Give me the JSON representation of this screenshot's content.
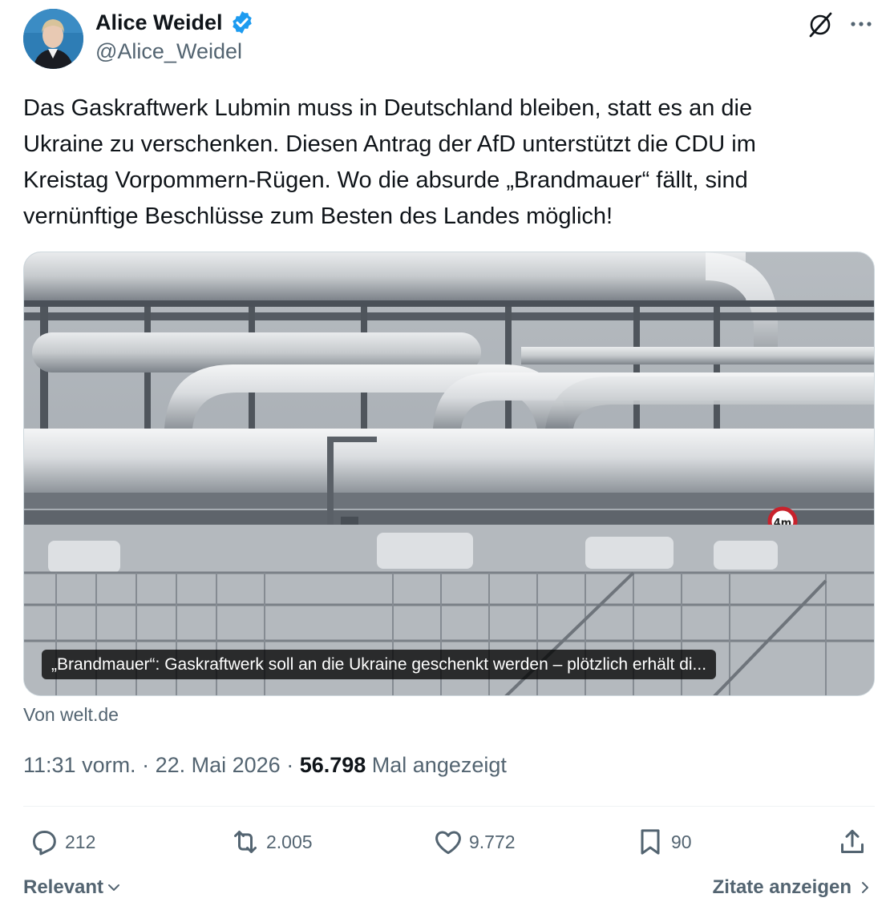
{
  "author": {
    "display_name": "Alice Weidel",
    "handle": "@Alice_Weidel",
    "avatar_icon": "profile-photo",
    "verified_color": "#1d9bf0"
  },
  "tweet": {
    "lines": [
      "Das Gaskraftwerk Lubmin muss in Deutschland bleiben, statt es an die",
      "Ukraine zu verschenken. Diesen Antrag der AfD unterstützt die CDU im",
      "Kreistag Vorpommern-Rügen. Wo die absurde „Brandmauer“ fällt, sind",
      "vernünftige Beschlüsse zum Besten des Landes möglich!"
    ]
  },
  "card": {
    "caption": "„Brandmauer“: Gaskraftwerk soll an die Ukraine geschenkt werden – plötzlich erhält di...",
    "sign_text": "4m",
    "source": "Von welt.de"
  },
  "meta": {
    "time": "11:31 vorm.",
    "sep1": " · ",
    "date": "22. Mai 2026",
    "sep2": " · ",
    "views": "56.798",
    "views_label": " Mal angezeigt"
  },
  "actions": {
    "replies": "212",
    "retweets": "2.005",
    "likes": "9.772",
    "bookmarks": "90"
  },
  "footer": {
    "sort_label": "Relevant",
    "quotes_label": "Zitate anzeigen"
  },
  "colors": {
    "text": "#0f1419",
    "muted": "#536471",
    "accent": "#1d9bf0"
  }
}
